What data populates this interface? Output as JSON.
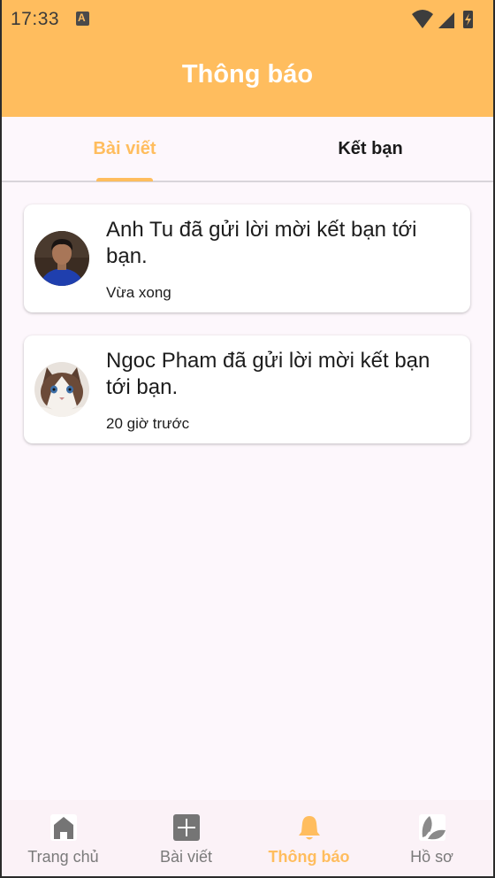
{
  "status_bar": {
    "time": "17:33",
    "icons": [
      "notification-a-icon",
      "wifi-icon",
      "signal-icon",
      "battery-charging-icon"
    ]
  },
  "header": {
    "title": "Thông báo"
  },
  "colors": {
    "accent": "#ffbd5e",
    "background": "#fdf7fc",
    "inactive": "#7a7a7a"
  },
  "tabs": [
    {
      "label": "Bài viết",
      "active": true
    },
    {
      "label": "Kết bạn",
      "active": false
    }
  ],
  "notifications": [
    {
      "text": "Anh Tu đã gửi lời mời kết bạn tới bạn.",
      "time": "Vừa xong",
      "avatar": "person-avatar"
    },
    {
      "text": "Ngoc Pham đã gửi lời mời kết bạn tới bạn.",
      "time": "20 giờ trước",
      "avatar": "cat-avatar"
    }
  ],
  "bottom_nav": [
    {
      "label": "Trang chủ",
      "icon": "home-icon",
      "active": false
    },
    {
      "label": "Bài viết",
      "icon": "add-post-icon",
      "active": false
    },
    {
      "label": "Thông báo",
      "icon": "bell-icon",
      "active": true
    },
    {
      "label": "Hồ sơ",
      "icon": "leaf-icon",
      "active": false
    }
  ]
}
